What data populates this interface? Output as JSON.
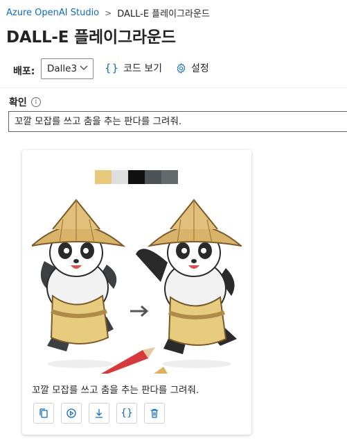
{
  "breadcrumb": {
    "root": "Azure OpenAI Studio",
    "current": "DALL-E 플레이그라운드"
  },
  "page_title": "DALL-E 플레이그라운드",
  "toolbar": {
    "deployment_label": "배포:",
    "deployment_value": "Dalle3",
    "view_code": "코드 보기",
    "settings": "설정"
  },
  "prompt": {
    "label": "확인",
    "value": "꼬깔 모잡를 쓰고 춤을 추는 판다를 그려줘."
  },
  "result": {
    "caption": "꼬깔 모잡를 쓰고 춤을 추는 판다를 그려줘.",
    "palette": [
      "#e8c87a",
      "#dcdedf",
      "#111111",
      "#4c5256",
      "#646a6c"
    ],
    "actions": [
      "copy-icon",
      "variation-icon",
      "download-icon",
      "code-icon",
      "delete-icon"
    ]
  },
  "colors": {
    "accent": "#0f6cbd",
    "text": "#242424"
  }
}
